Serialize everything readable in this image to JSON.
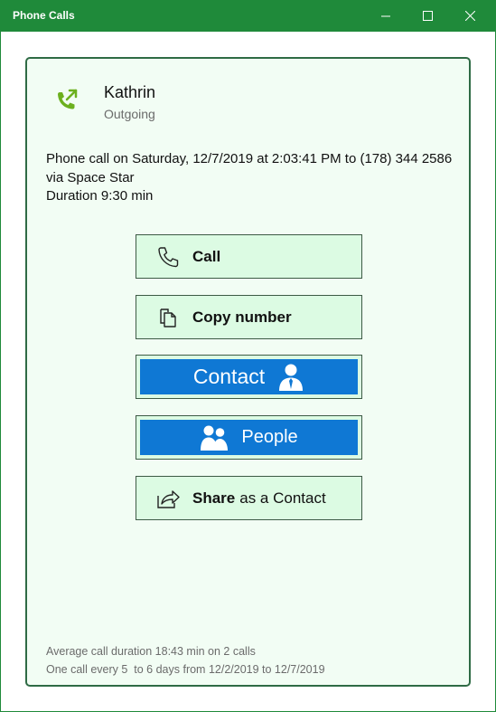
{
  "window": {
    "title": "Phone Calls",
    "controls": [
      "minimize-icon",
      "maximize-icon",
      "close-icon"
    ]
  },
  "call": {
    "contact_name": "Kathrin",
    "direction": "Outgoing",
    "icon": "phone-outgoing-icon",
    "description": "Phone call on Saturday, 12/7/2019 at 2:03:41 PM to (178) 344 2586 via Space Star",
    "duration": "Duration 9:30 min"
  },
  "actions": {
    "call_label": "Call",
    "copy_label": "Copy number",
    "contact_label": "Contact",
    "people_label": "People",
    "share_label_bold": "Share",
    "share_label_rest": "as a Contact"
  },
  "stats": {
    "average": "Average call duration 18:43 min on 2 calls",
    "frequency": "One call every 5  to 6 days from 12/2/2019 to 12/7/2019"
  },
  "colors": {
    "titlebar": "#1f8a3a",
    "card_background": "#f2fdf4",
    "button_background": "#dcfbe3",
    "accent_blue": "#0f78d4",
    "phone_icon": "#6cb01e"
  }
}
